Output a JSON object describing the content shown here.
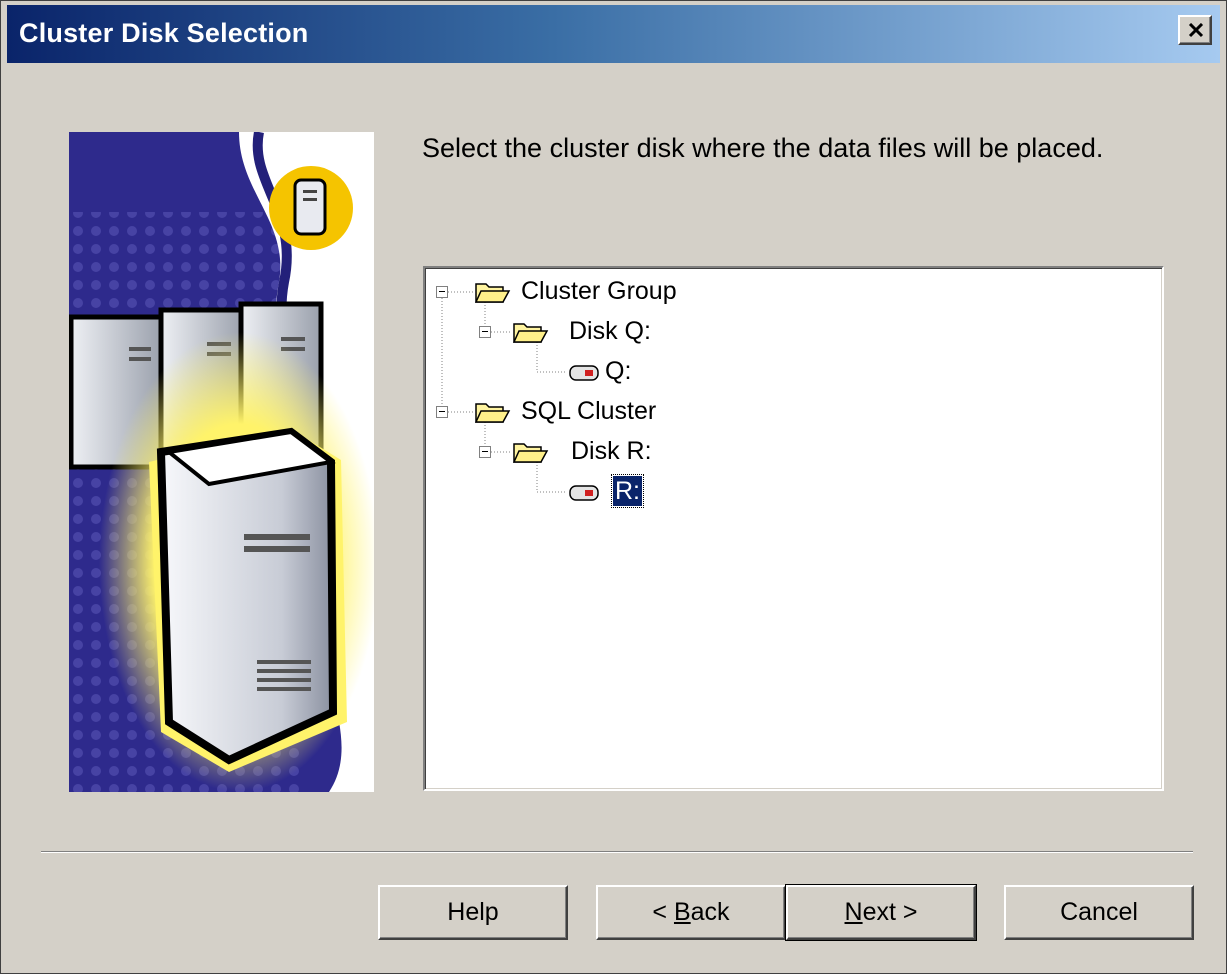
{
  "window": {
    "title": "Cluster Disk Selection",
    "close_icon": "close-icon"
  },
  "instruction": "Select the cluster disk where the data files will be placed.",
  "tree": {
    "nodes": [
      {
        "label": "Cluster Group",
        "icon": "open-folder-icon",
        "expanded": true
      },
      {
        "label": "Disk Q:",
        "icon": "open-folder-icon",
        "expanded": true
      },
      {
        "label": "Q:",
        "icon": "drive-icon"
      },
      {
        "label": "SQL Cluster",
        "icon": "open-folder-icon",
        "expanded": true
      },
      {
        "label": "Disk R:",
        "icon": "open-folder-icon",
        "expanded": true
      },
      {
        "label": "R:",
        "icon": "drive-icon",
        "selected": true
      }
    ]
  },
  "buttons": {
    "help": "Help",
    "back_prefix": "< ",
    "back_mnemonic": "B",
    "back_rest": "ack",
    "next_mnemonic": "N",
    "next_rest": "ext >",
    "cancel": "Cancel"
  },
  "colors": {
    "titlebar_start": "#0a246a",
    "titlebar_end": "#a6caf0",
    "dialog_face": "#d4d0c8",
    "selection": "#0a246a"
  }
}
